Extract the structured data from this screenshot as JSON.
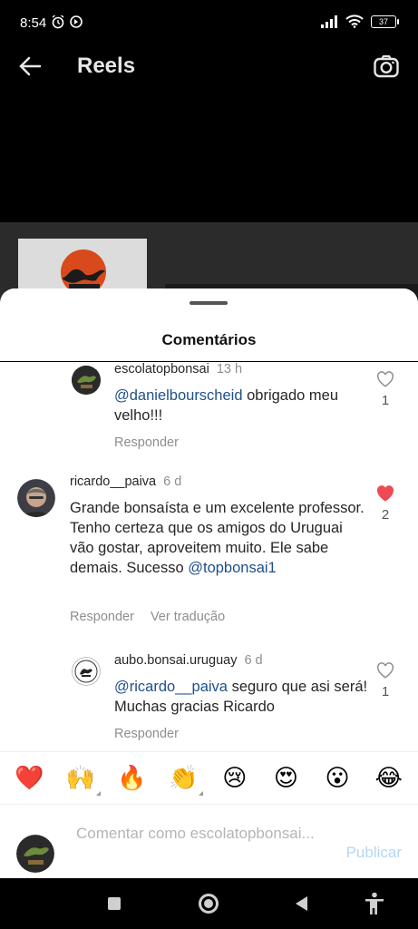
{
  "status_bar": {
    "time": "8:54",
    "battery": "37"
  },
  "header": {
    "title": "Reels"
  },
  "sheet": {
    "title": "Comentários"
  },
  "comments": [
    {
      "username": "escolatopbonsai",
      "time": "13 h",
      "mention": "@danielbourscheid",
      "text": " obrigado meu velho!!!",
      "reply_label": "Responder",
      "likes": "1",
      "liked": false
    },
    {
      "username": "ricardo__paiva",
      "time": "6 d",
      "text": "Grande bonsaísta e um excelente professor. Tenho certeza que os amigos do Uruguai vão gostar, aproveitem muito. Ele sabe demais. Sucesso ",
      "mention": "@topbonsai1",
      "reply_label": "Responder",
      "translate_label": "Ver tradução",
      "likes": "2",
      "liked": true
    },
    {
      "username": "aubo.bonsai.uruguay",
      "time": "6 d",
      "mention": "@ricardo__paiva",
      "text": " seguro que asi será! Muchas gracias Ricardo",
      "reply_label": "Responder",
      "likes": "1",
      "liked": false
    }
  ],
  "emoji_bar": [
    "❤️",
    "🙌",
    "🔥",
    "👏",
    "😢",
    "😍",
    "😮",
    "😂"
  ],
  "composer": {
    "placeholder": "Comentar como escolatopbonsai...",
    "publish_label": "Publicar"
  },
  "colors": {
    "mention": "#1f4f8a",
    "liked_heart": "#ed4956",
    "publish": "#b3d7f3"
  }
}
